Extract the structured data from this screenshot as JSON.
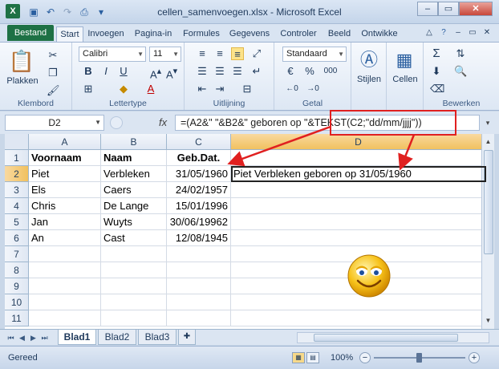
{
  "window": {
    "title": "cellen_samenvoegen.xlsx - Microsoft Excel",
    "app_icon": "X"
  },
  "ribbon_tabs": {
    "file": "Bestand",
    "tabs": [
      "Start",
      "Invoegen",
      "Pagina-in",
      "Formules",
      "Gegevens",
      "Controler",
      "Beeld",
      "Ontwikke"
    ],
    "active": "Start"
  },
  "ribbon": {
    "clipboard": {
      "paste": "Plakken",
      "label": "Klembord"
    },
    "font": {
      "name": "Calibri",
      "size": "11",
      "bold": "B",
      "italic": "I",
      "underline": "U",
      "label": "Lettertype"
    },
    "alignment": {
      "label": "Uitlijning"
    },
    "number": {
      "format": "Standaard",
      "currency": "€",
      "percent": "%",
      "thousands": "000",
      "label": "Getal"
    },
    "styles": {
      "label": "Stijlen"
    },
    "cells": {
      "label": "Cellen"
    },
    "editing": {
      "label": "Bewerken"
    }
  },
  "formula_bar": {
    "name_box": "D2",
    "fx": "fx",
    "formula": "=(A2&\" \"&B2&\" geboren op \"&TEKST(C2;\"dd/mm/jjjj\"))",
    "highlighted_part": "TEKST(C2;\"dd/mm/jjjj\"))"
  },
  "sheet": {
    "columns": [
      "A",
      "B",
      "C",
      "D"
    ],
    "selected_column": "D",
    "selected_row": "2",
    "rows": [
      {
        "n": "1",
        "a": "Voornaam",
        "b": "Naam",
        "c": "Geb.Dat.",
        "d": ""
      },
      {
        "n": "2",
        "a": "Piet",
        "b": "Verbleken",
        "c": "31/05/1960",
        "d": "Piet Verbleken geboren op 31/05/1960"
      },
      {
        "n": "3",
        "a": "Els",
        "b": "Caers",
        "c": "24/02/1957",
        "d": ""
      },
      {
        "n": "4",
        "a": "Chris",
        "b": "De Lange",
        "c": "15/01/1996",
        "d": ""
      },
      {
        "n": "5",
        "a": "Jan",
        "b": "Wuyts",
        "c": "30/06/19962",
        "d": ""
      },
      {
        "n": "6",
        "a": "An",
        "b": "Cast",
        "c": "12/08/1945",
        "d": ""
      },
      {
        "n": "7",
        "a": "",
        "b": "",
        "c": "",
        "d": ""
      },
      {
        "n": "8",
        "a": "",
        "b": "",
        "c": "",
        "d": ""
      },
      {
        "n": "9",
        "a": "",
        "b": "",
        "c": "",
        "d": ""
      },
      {
        "n": "10",
        "a": "",
        "b": "",
        "c": "",
        "d": ""
      },
      {
        "n": "11",
        "a": "",
        "b": "",
        "c": "",
        "d": ""
      }
    ]
  },
  "sheet_tabs": {
    "tabs": [
      "Blad1",
      "Blad2",
      "Blad3"
    ],
    "active": "Blad1"
  },
  "status": {
    "text": "Gereed",
    "zoom": "100%"
  },
  "colors": {
    "file_tab": "#1e7145",
    "annotation": "#e02020",
    "selection": "#f1c15f"
  }
}
